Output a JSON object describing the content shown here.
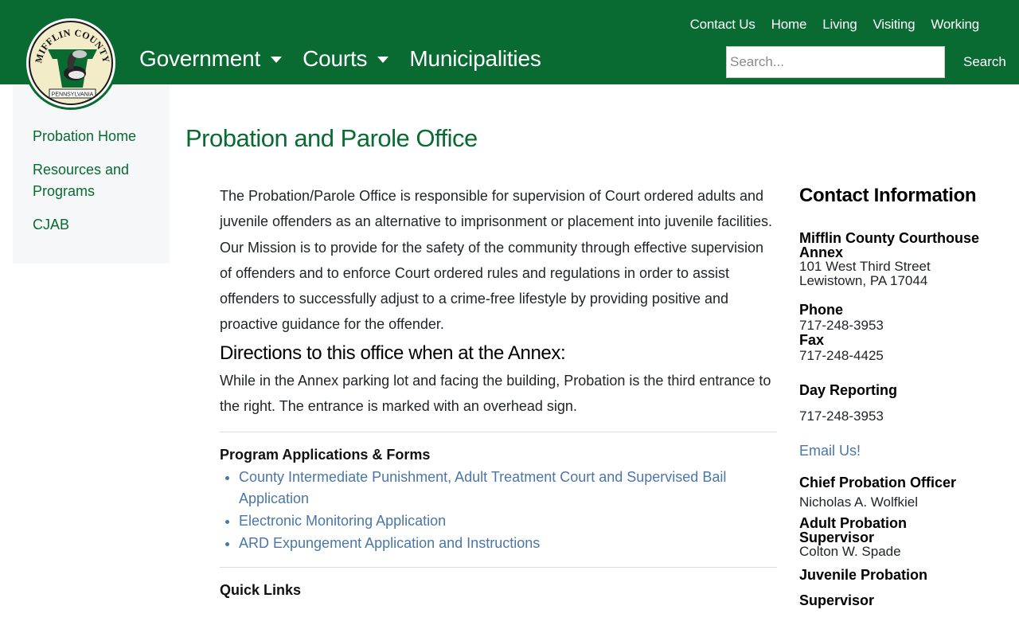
{
  "header": {
    "logo_text_top": "MIFFLIN COUNTY",
    "logo_text_bottom": "PENNSYLVANIA",
    "utility_nav": [
      "Contact Us",
      "Home",
      "Living",
      "Visiting",
      "Working"
    ],
    "main_nav": [
      {
        "label": "Government",
        "dropdown": true
      },
      {
        "label": "Courts",
        "dropdown": true
      },
      {
        "label": "Municipalities",
        "dropdown": false
      }
    ],
    "search_placeholder": "Search...",
    "search_button": "Search"
  },
  "sidebar": {
    "items": [
      "Probation Home",
      "Resources and Programs",
      "CJAB"
    ]
  },
  "main": {
    "title": "Probation and Parole Office",
    "intro": "The Probation/Parole Office is responsible for supervision of Court ordered adults and juvenile offenders as an alternative to imprisonment or placement into juvenile facilities.",
    "mission": "Our Mission is to provide for the safety of the community through effective supervision of offenders and to enforce Court ordered rules and regulations in order to assist offenders to successfully adjust to a crime-free lifestyle by providing positive and proactive guidance for the offender.",
    "directions_heading": "Directions to this office when at the Annex:",
    "directions_text": "While in the Annex parking lot and facing the building, Probation is the third entrance to the right.  The entrance is marked with an overhead sign.",
    "forms_heading": "Program Applications & Forms",
    "forms": [
      "County Intermediate Punishment, Adult Treatment Court and Supervised Bail Application",
      "Electronic Monitoring Application",
      "ARD Expungement Application and Instructions"
    ],
    "quick_links_heading": "Quick Links"
  },
  "contact": {
    "heading": "Contact Information",
    "location_name": "Mifflin County Courthouse Annex",
    "address_line1": "101 West Third Street",
    "address_line2": "Lewistown, PA 17044",
    "phone_label": "Phone",
    "phone": "717-248-3953",
    "fax_label": "Fax",
    "fax": "717-248-4425",
    "day_reporting_label": "Day Reporting",
    "day_reporting_phone": "717-248-3953",
    "email_link": "Email Us!",
    "chief_label": "Chief Probation Officer",
    "chief_name": "Nicholas A. Wolfkiel",
    "adult_sup_label": "Adult Probation Supervisor",
    "adult_sup_name": "Colton W. Spade",
    "juvenile_label_1": "Juvenile Probation",
    "juvenile_label_2": "Supervisor"
  },
  "colors": {
    "brand_green": "#096a32",
    "link_blue": "#4a76a8",
    "sidebar_bg": "#f5f7f8"
  }
}
